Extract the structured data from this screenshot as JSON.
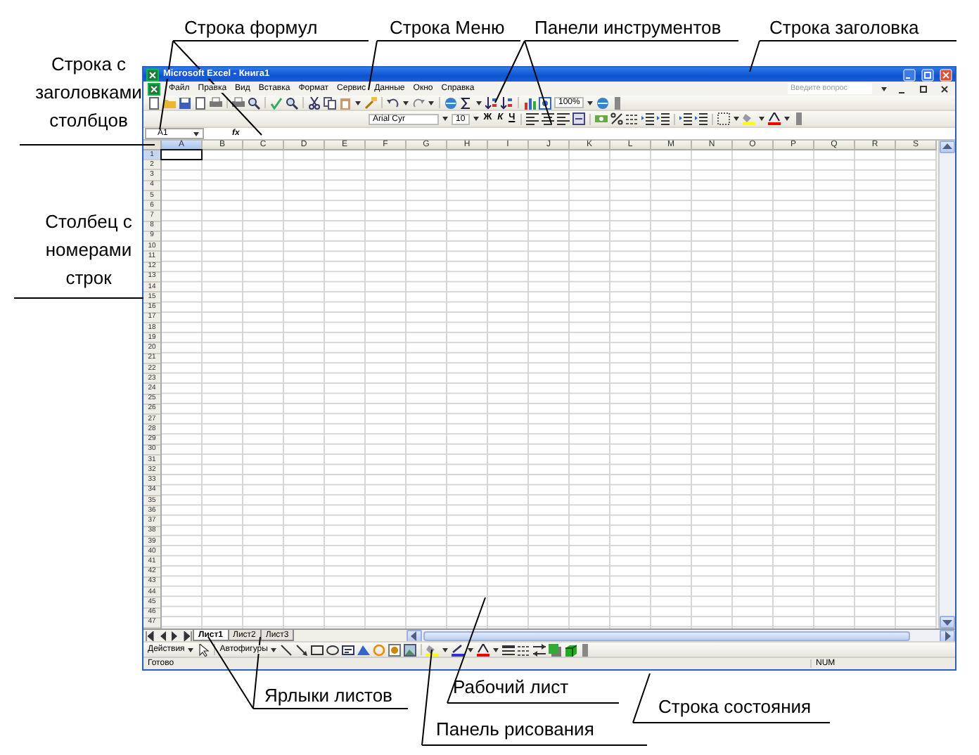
{
  "window": {
    "title": "Microsoft Excel - Книга1",
    "help_placeholder": "Введите вопрос"
  },
  "menu": [
    "Файл",
    "Правка",
    "Вид",
    "Вставка",
    "Формат",
    "Сервис",
    "Данные",
    "Окно",
    "Справка"
  ],
  "standard_toolbar": {
    "zoom": "100%"
  },
  "formatting_toolbar": {
    "font": "Arial Cyr",
    "size": "10",
    "bold": "Ж",
    "italic": "К",
    "underline": "Ч"
  },
  "formula_bar": {
    "name_box": "A1",
    "function_label": "fx"
  },
  "columns": [
    {
      "label": "A",
      "selected": true
    },
    {
      "label": "B",
      "selected": false
    },
    {
      "label": "C",
      "selected": false
    },
    {
      "label": "D",
      "selected": false
    },
    {
      "label": "E",
      "selected": false
    },
    {
      "label": "F",
      "selected": false
    },
    {
      "label": "G",
      "selected": false
    },
    {
      "label": "H",
      "selected": false
    },
    {
      "label": "I",
      "selected": false
    },
    {
      "label": "J",
      "selected": false
    },
    {
      "label": "K",
      "selected": false
    },
    {
      "label": "L",
      "selected": false
    },
    {
      "label": "M",
      "selected": false
    },
    {
      "label": "N",
      "selected": false
    },
    {
      "label": "O",
      "selected": false
    },
    {
      "label": "P",
      "selected": false
    },
    {
      "label": "Q",
      "selected": false
    },
    {
      "label": "R",
      "selected": false
    },
    {
      "label": "S",
      "selected": false
    }
  ],
  "rows": [
    {
      "label": "1",
      "selected": true
    },
    {
      "label": "2",
      "selected": false
    },
    {
      "label": "3",
      "selected": false
    },
    {
      "label": "4",
      "selected": false
    },
    {
      "label": "5",
      "selected": false
    },
    {
      "label": "6",
      "selected": false
    },
    {
      "label": "7",
      "selected": false
    },
    {
      "label": "8",
      "selected": false
    },
    {
      "label": "9",
      "selected": false
    },
    {
      "label": "10",
      "selected": false
    },
    {
      "label": "11",
      "selected": false
    },
    {
      "label": "12",
      "selected": false
    },
    {
      "label": "13",
      "selected": false
    },
    {
      "label": "14",
      "selected": false
    },
    {
      "label": "15",
      "selected": false
    },
    {
      "label": "16",
      "selected": false
    },
    {
      "label": "17",
      "selected": false
    },
    {
      "label": "18",
      "selected": false
    },
    {
      "label": "19",
      "selected": false
    },
    {
      "label": "20",
      "selected": false
    },
    {
      "label": "21",
      "selected": false
    },
    {
      "label": "22",
      "selected": false
    },
    {
      "label": "23",
      "selected": false
    },
    {
      "label": "24",
      "selected": false
    },
    {
      "label": "25",
      "selected": false
    },
    {
      "label": "26",
      "selected": false
    },
    {
      "label": "27",
      "selected": false
    },
    {
      "label": "28",
      "selected": false
    },
    {
      "label": "29",
      "selected": false
    },
    {
      "label": "30",
      "selected": false
    },
    {
      "label": "31",
      "selected": false
    },
    {
      "label": "32",
      "selected": false
    },
    {
      "label": "33",
      "selected": false
    },
    {
      "label": "34",
      "selected": false
    },
    {
      "label": "35",
      "selected": false
    },
    {
      "label": "36",
      "selected": false
    },
    {
      "label": "37",
      "selected": false
    },
    {
      "label": "38",
      "selected": false
    },
    {
      "label": "39",
      "selected": false
    },
    {
      "label": "40",
      "selected": false
    },
    {
      "label": "41",
      "selected": false
    },
    {
      "label": "42",
      "selected": false
    },
    {
      "label": "43",
      "selected": false
    },
    {
      "label": "44",
      "selected": false
    },
    {
      "label": "45",
      "selected": false
    },
    {
      "label": "46",
      "selected": false
    },
    {
      "label": "47",
      "selected": false
    }
  ],
  "sheet_tabs": [
    {
      "label": "Лист1",
      "selected": true
    },
    {
      "label": "Лист2",
      "selected": false
    },
    {
      "label": "Лист3",
      "selected": false
    }
  ],
  "drawing_toolbar": {
    "actions": "Действия",
    "autoshapes": "Автофигуры"
  },
  "status_bar": {
    "text": "Готово",
    "indicator": "NUM"
  },
  "annotations": [
    {
      "text": "Строка формул"
    },
    {
      "text": "Строка Меню"
    },
    {
      "text": "Панели инструментов"
    },
    {
      "text": "Строка заголовка"
    },
    {
      "text": "Строка с заголовками столбцов"
    },
    {
      "text": "Столбец с номерами строк"
    },
    {
      "text": "Ярлыки листов"
    },
    {
      "text": "Рабочий лист"
    },
    {
      "text": "Строка состояния"
    },
    {
      "text": "Панель рисования"
    }
  ]
}
